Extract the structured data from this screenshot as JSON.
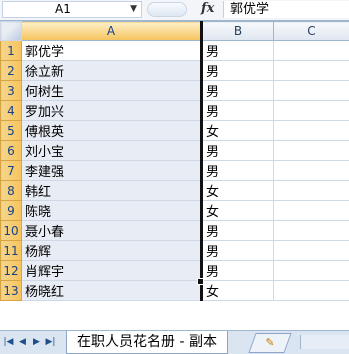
{
  "formula_bar": {
    "name_box": "A1",
    "fx_label": "fx",
    "formula_value": "郭优学"
  },
  "columns": [
    "A",
    "B",
    "C"
  ],
  "rows": [
    {
      "n": "1",
      "a": "郭优学",
      "b": "男"
    },
    {
      "n": "2",
      "a": "徐立新",
      "b": "男"
    },
    {
      "n": "3",
      "a": "何树生",
      "b": "男"
    },
    {
      "n": "4",
      "a": "罗加兴",
      "b": "男"
    },
    {
      "n": "5",
      "a": "傅根英",
      "b": "女"
    },
    {
      "n": "6",
      "a": "刘小宝",
      "b": "男"
    },
    {
      "n": "7",
      "a": "李建强",
      "b": "男"
    },
    {
      "n": "8",
      "a": "韩红",
      "b": "女"
    },
    {
      "n": "9",
      "a": "陈晓",
      "b": "女"
    },
    {
      "n": "10",
      "a": "聂小春",
      "b": "男"
    },
    {
      "n": "11",
      "a": "杨辉",
      "b": "男"
    },
    {
      "n": "12",
      "a": "肖辉宇",
      "b": "男"
    },
    {
      "n": "13",
      "a": "杨晓红",
      "b": "女"
    }
  ],
  "sheet_tabs": {
    "nav_icons": [
      "first-sheet-icon",
      "prev-sheet-icon",
      "next-sheet-icon",
      "last-sheet-icon"
    ],
    "active_tab": "在职人员花名册 - 副本",
    "new_sheet_icon": "new-sheet-icon"
  }
}
